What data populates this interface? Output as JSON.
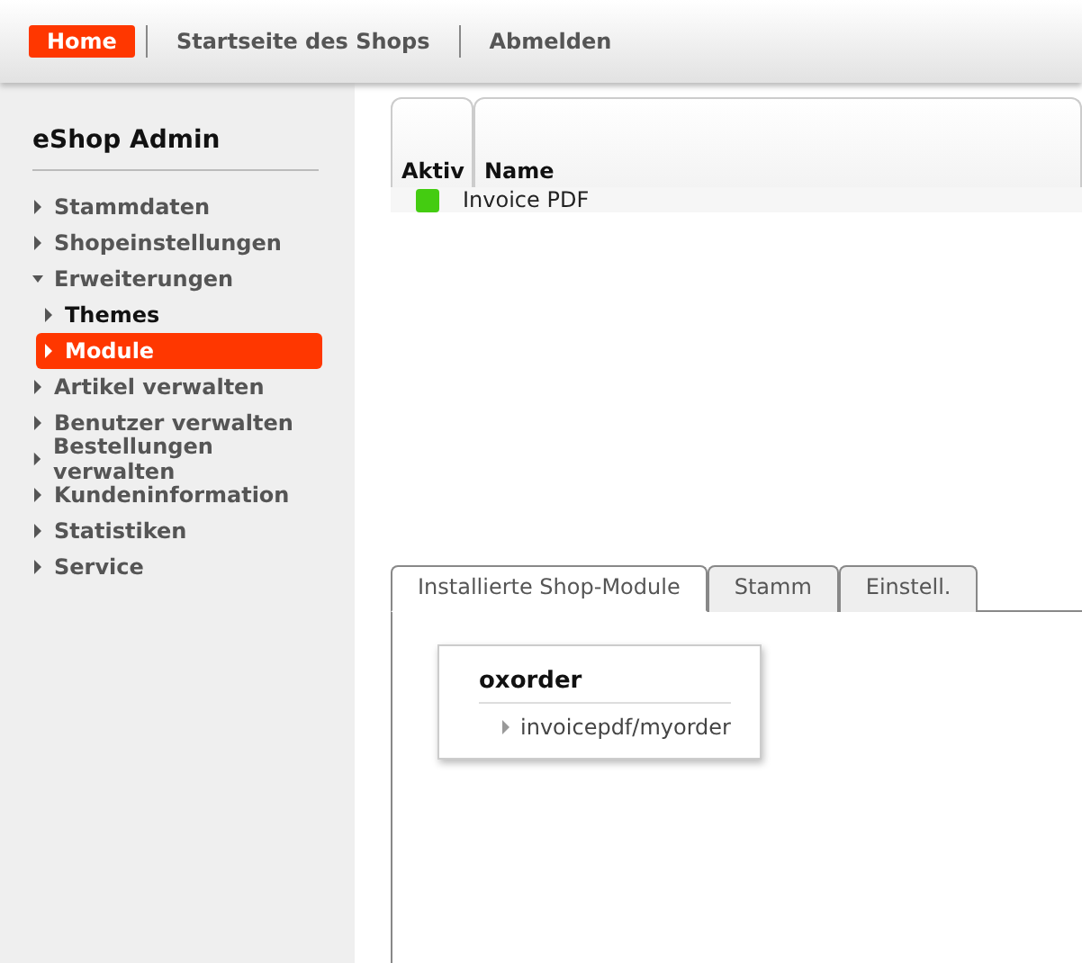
{
  "top_nav": [
    {
      "label": "Home",
      "selected": true
    },
    {
      "label": "Startseite des Shops",
      "selected": false
    },
    {
      "label": "Abmelden",
      "selected": false
    }
  ],
  "sidebar": {
    "title": "eShop Admin",
    "items": [
      {
        "label": "Stammdaten",
        "expanded": false,
        "selected": false
      },
      {
        "label": "Shopeinstellungen",
        "expanded": false,
        "selected": false
      },
      {
        "label": "Erweiterungen",
        "expanded": true,
        "selected": false,
        "children": [
          {
            "label": "Themes",
            "expanded": false,
            "selected": false
          },
          {
            "label": "Module",
            "expanded": false,
            "selected": true
          }
        ]
      },
      {
        "label": "Artikel verwalten",
        "expanded": false,
        "selected": false
      },
      {
        "label": "Benutzer verwalten",
        "expanded": false,
        "selected": false
      },
      {
        "label": "Bestellungen verwalten",
        "expanded": false,
        "selected": false
      },
      {
        "label": "Kundeninformation",
        "expanded": false,
        "selected": false
      },
      {
        "label": "Statistiken",
        "expanded": false,
        "selected": false
      },
      {
        "label": "Service",
        "expanded": false,
        "selected": false
      }
    ]
  },
  "module_table": {
    "columns": [
      "Aktiv",
      "Name"
    ],
    "rows": [
      {
        "active": true,
        "name": "Invoice PDF"
      }
    ]
  },
  "tabs": [
    {
      "label": "Installierte Shop-Module",
      "selected": true
    },
    {
      "label": "Stamm",
      "selected": false
    },
    {
      "label": "Einstell.",
      "selected": false
    }
  ],
  "extension_box": {
    "title": "oxorder",
    "items": [
      "invoicepdf/myorder"
    ]
  }
}
